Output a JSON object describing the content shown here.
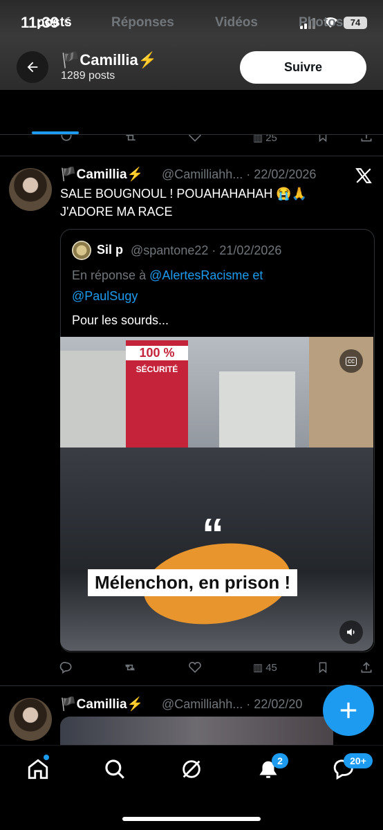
{
  "status": {
    "time": "11:39",
    "battery": "74"
  },
  "header": {
    "name": "🏴Camillia⚡",
    "posts_count": "1289 posts",
    "follow_label": "Suivre"
  },
  "tabs": [
    {
      "label": "posts"
    },
    {
      "label": "Réponses"
    },
    {
      "label": "Vidéos"
    },
    {
      "label": "Photos"
    }
  ],
  "prev_tweet": {
    "views": "25"
  },
  "tweet": {
    "name": "🏴Camillia⚡",
    "handle_date": "@Camilliahh... · 22/02/2026",
    "text_line1": "SALE BOUGNOUL ! POUAHAHAHAH 😭🙏",
    "text_line2": "J'ADORE MA RACE",
    "views": "45",
    "quote": {
      "name": "Sil p",
      "handle_date": "@spantone22 · 21/02/2026",
      "reply_prefix": "En réponse à",
      "mention1": "@AlertesRacisme",
      "and_word": "et",
      "mention2": "@PaulSugy",
      "text": "Pour les sourds...",
      "video_caption": "Mélenchon, en prison !",
      "quote_mark": "“",
      "sign_pct": "100 %",
      "sign_word": "SÉCURITÉ"
    }
  },
  "next_tweet": {
    "name": "🏴Camillia⚡",
    "handle_date": "@Camilliahh... · 22/02/20"
  },
  "nav": {
    "notif_badge": "2",
    "msg_badge": "20+"
  },
  "colors": {
    "accent": "#1d9bf0",
    "bg": "#000000",
    "muted": "#71767b"
  }
}
